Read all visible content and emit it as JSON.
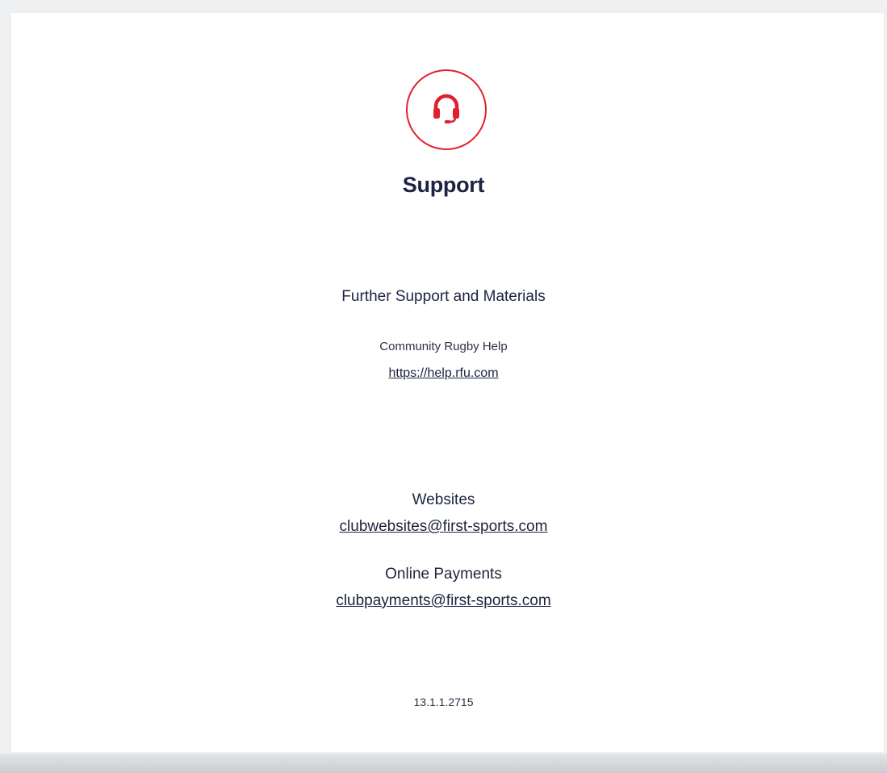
{
  "header": {
    "icon": "headset-icon",
    "accent_color": "#e0202e",
    "title": "Support"
  },
  "materials": {
    "heading": "Further Support and Materials",
    "help_label": "Community Rugby Help",
    "help_link": "https://help.rfu.com"
  },
  "contacts": [
    {
      "label": "Websites",
      "email": "clubwebsites@first-sports.com"
    },
    {
      "label": "Online Payments",
      "email": "clubpayments@first-sports.com"
    }
  ],
  "footer": {
    "version": "13.1.1.2715"
  }
}
